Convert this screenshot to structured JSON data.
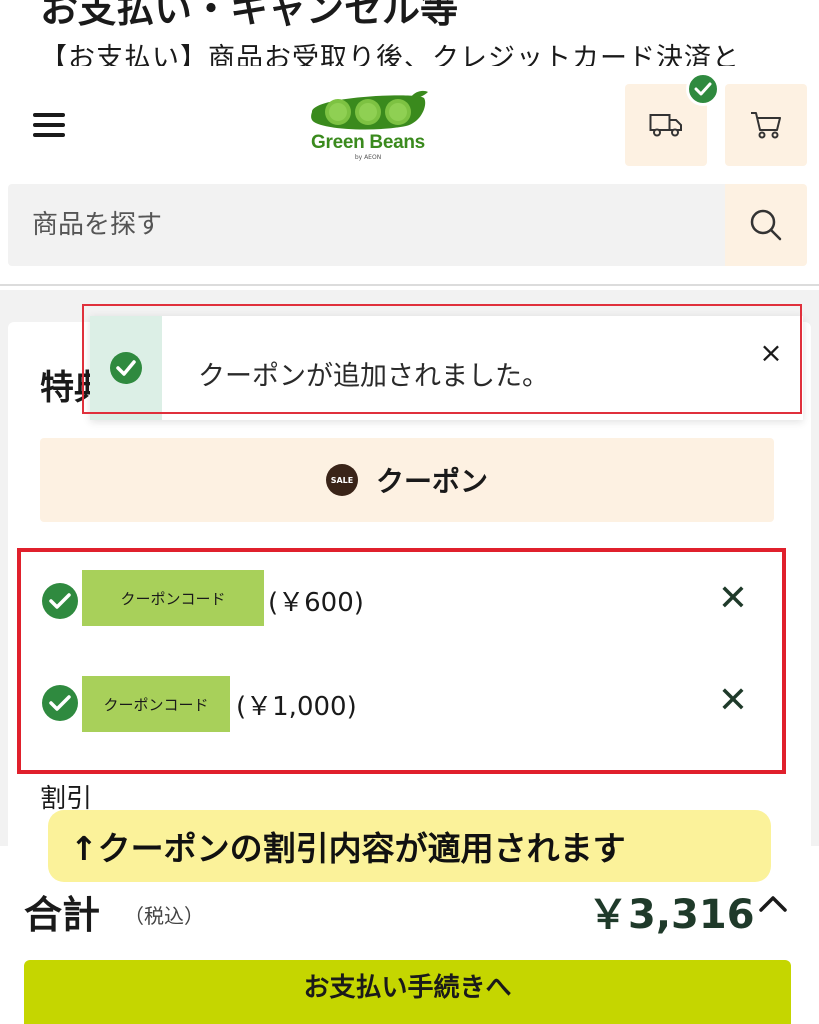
{
  "page": {
    "top_heading": "お支払い・キャンセル等",
    "top_sub": "【お支払い】商品お受取り後、クレジットカード決済と"
  },
  "header": {
    "menu_icon": "hamburger-menu-icon",
    "logo_text": "Green Beans",
    "logo_sub": "by AEON",
    "truck_icon": "delivery-truck-icon",
    "cart_icon": "shopping-cart-icon",
    "badge_icon": "check-icon",
    "brand_color": "#3a8a1d"
  },
  "search": {
    "placeholder": "商品を探す",
    "icon": "search-icon"
  },
  "section": {
    "title": "特典"
  },
  "toast": {
    "message": "クーポンが追加されました。",
    "close_label": "×",
    "icon": "check-circle-icon"
  },
  "coupon_button": {
    "label": "クーポン",
    "icon_text": "SALE"
  },
  "coupons": [
    {
      "code": "クーポンコード",
      "amount": "(￥600)",
      "remove": "✕"
    },
    {
      "code": "クーポンコード",
      "amount": "(￥1,000)",
      "remove": "✕"
    }
  ],
  "discount": {
    "label": "割引"
  },
  "callout": {
    "text": "↑クーポンの割引内容が適用されます"
  },
  "total": {
    "label": "合計",
    "tax_note": "（税込）",
    "amount": "￥3,316"
  },
  "checkout": {
    "label": "お支払い手続きへ"
  },
  "colors": {
    "accent_green": "#2f8a3f",
    "pay_button": "#c5d600",
    "peach": "#fdf1e2",
    "highlight_red": "#e0202c",
    "coupon_code_bg": "#a8d05a"
  }
}
